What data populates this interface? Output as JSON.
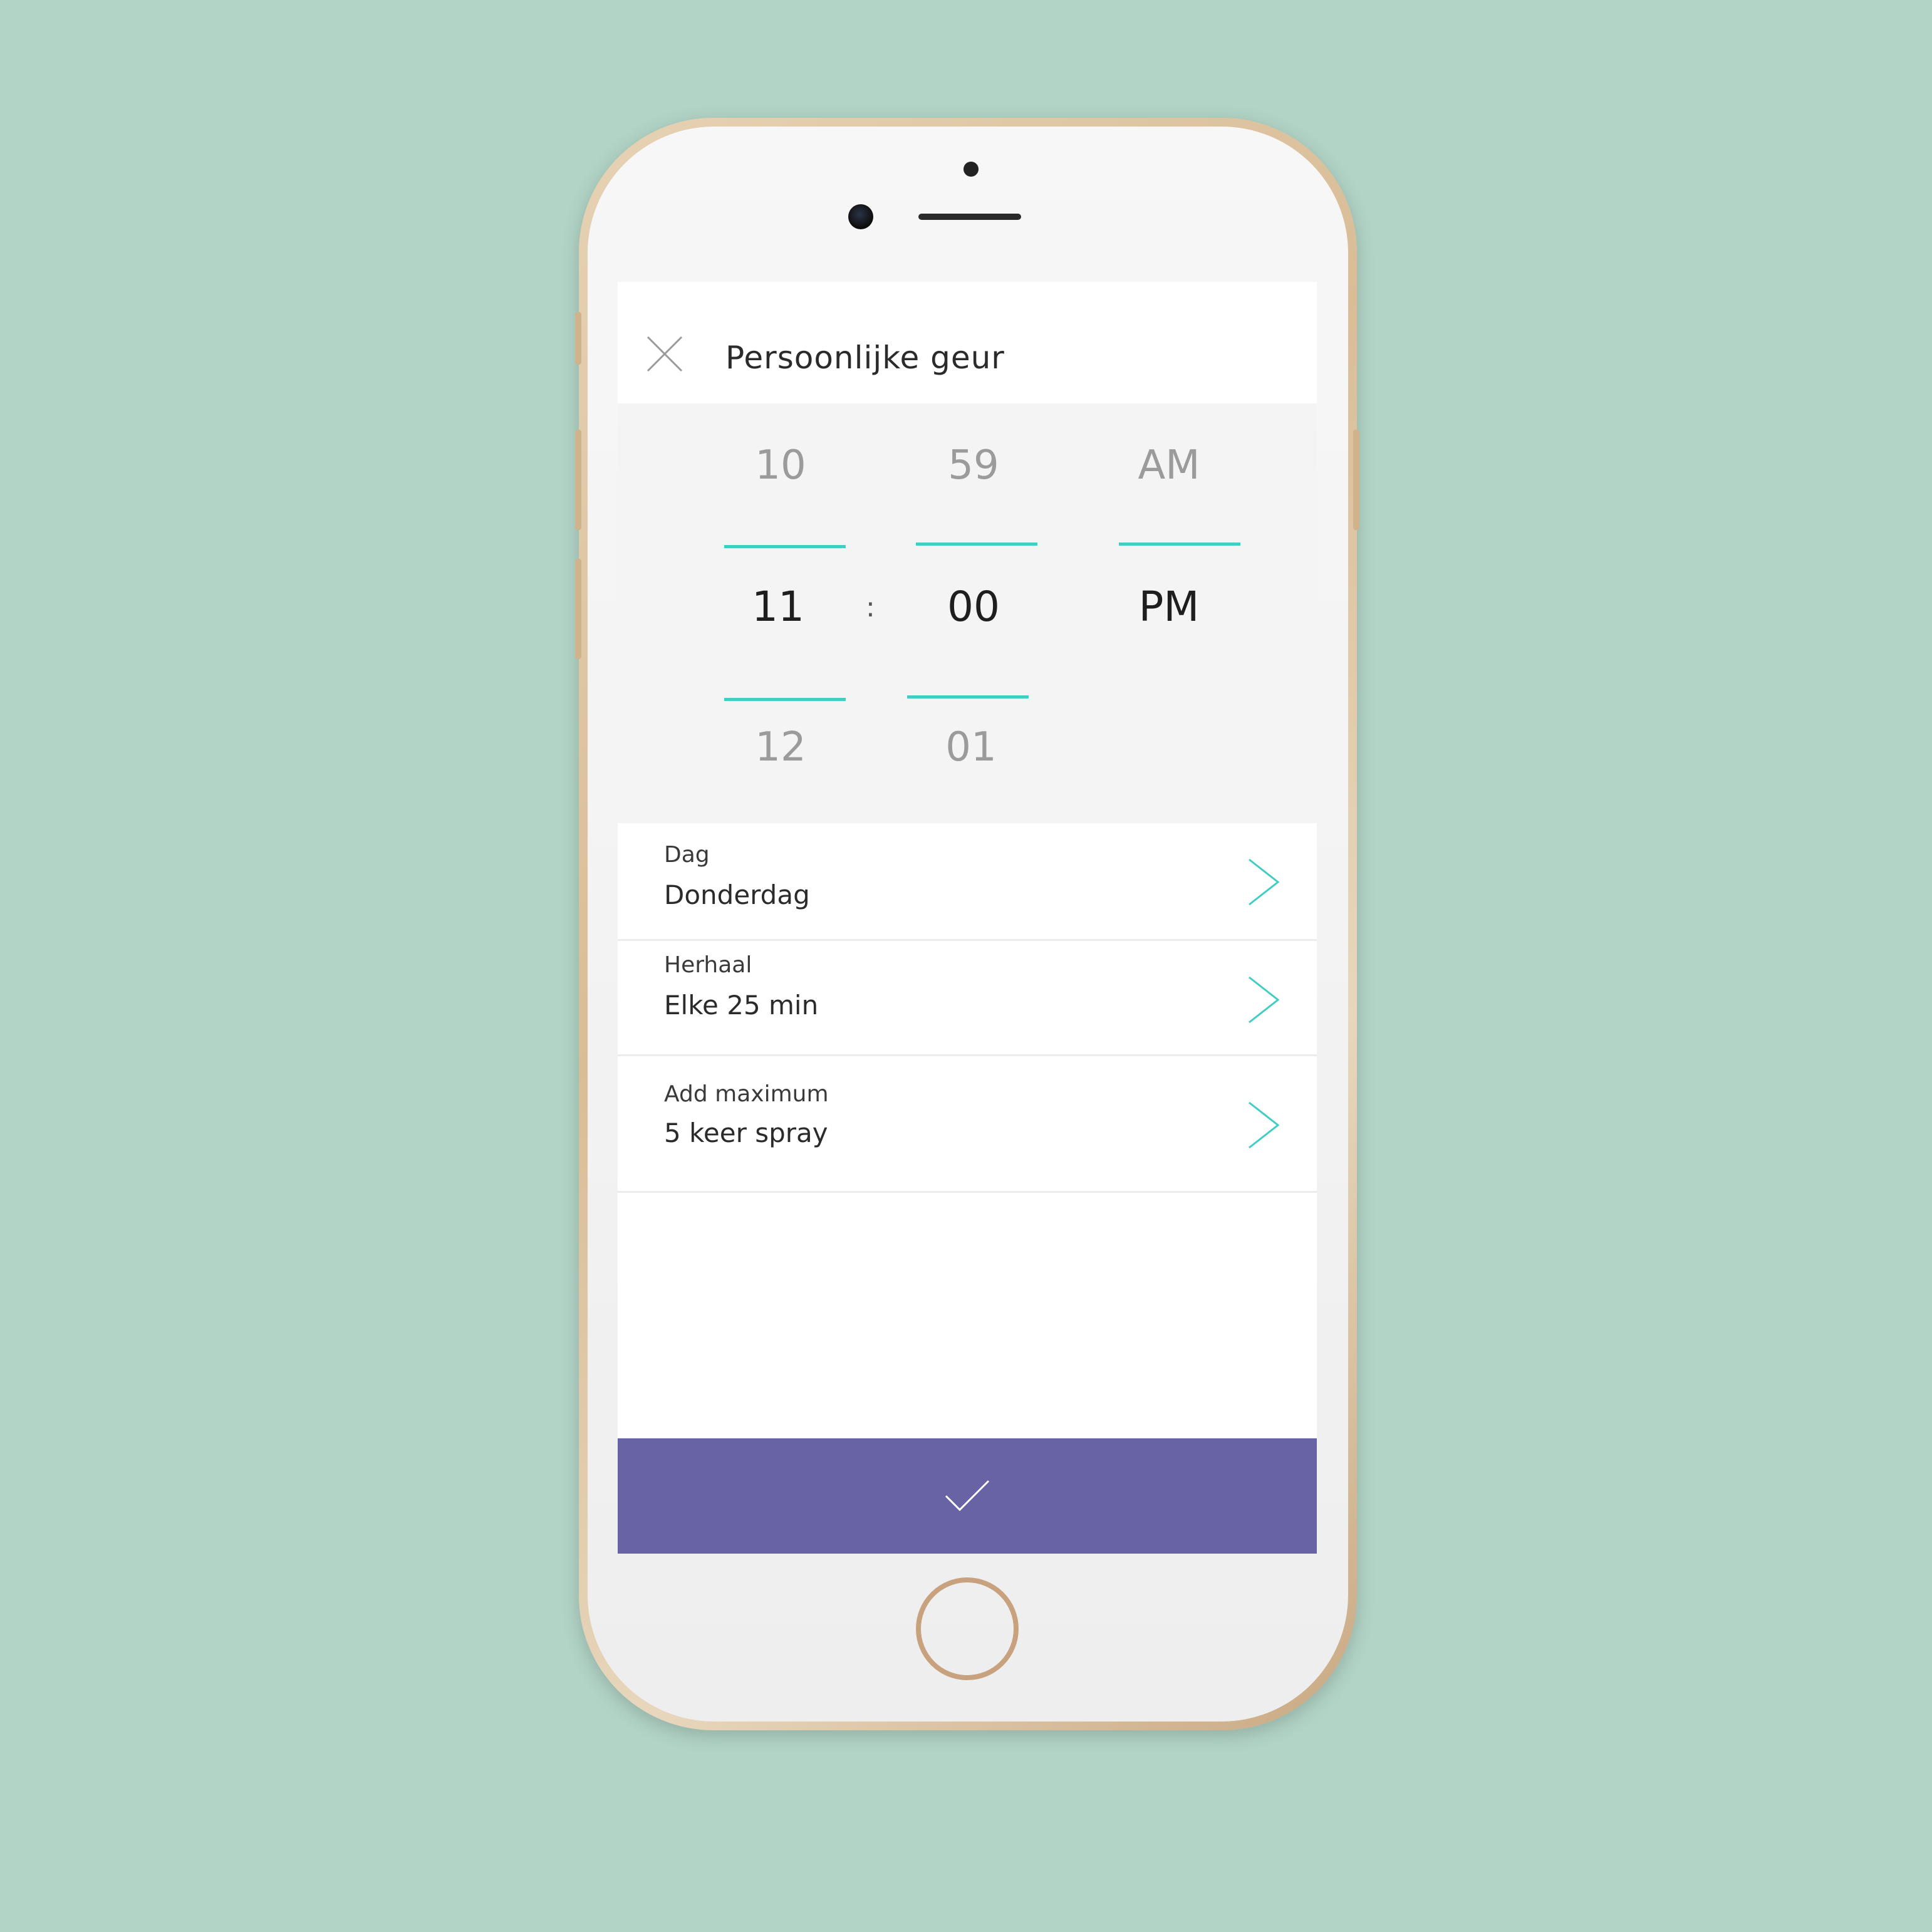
{
  "header": {
    "title": "Persoonlijke geur"
  },
  "time_picker": {
    "hours": {
      "above": "10",
      "selected": "11",
      "below": "12"
    },
    "separator": ":",
    "minutes": {
      "above": "59",
      "selected": "00",
      "below": "01"
    },
    "period": {
      "above": "AM",
      "selected": "PM"
    }
  },
  "settings": [
    {
      "label": "Dag",
      "value": "Donderdag"
    },
    {
      "label": "Herhaal",
      "value": "Elke 25 min"
    },
    {
      "label": "Add maximum",
      "value": "5 keer spray"
    }
  ],
  "colors": {
    "background": "#b2d4c6",
    "accent": "#3fcdc4",
    "confirm_bar": "#6863a5"
  },
  "icons": {
    "close": "close-icon",
    "chevron": "chevron-right-icon",
    "confirm": "checkmark-icon"
  }
}
